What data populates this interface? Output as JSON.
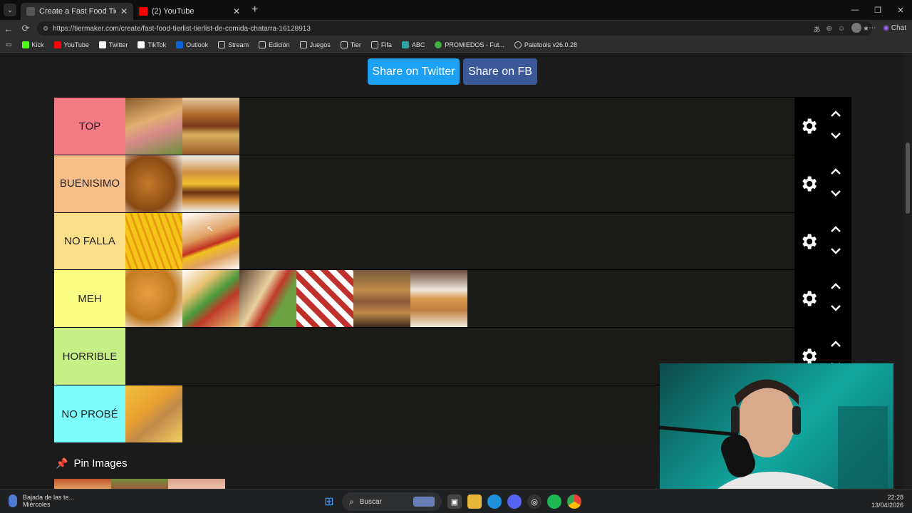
{
  "browser": {
    "tabs": [
      {
        "title": "Create a Fast Food Tierlist/Tierlist",
        "active": true
      },
      {
        "title": "(2) YouTube",
        "active": false
      }
    ],
    "url": "https://tiermaker.com/create/fast-food-tierlist-tierlist-de-comida-chatarra-16128913",
    "chat_label": "Chat",
    "bookmarks": [
      {
        "label": "Kick",
        "icon": "kick-icon",
        "color": "#53fc18"
      },
      {
        "label": "YouTube",
        "icon": "youtube-icon",
        "color": "#ff0000"
      },
      {
        "label": "Twitter",
        "icon": "x-icon",
        "color": "#ffffff"
      },
      {
        "label": "TikTok",
        "icon": "tiktok-icon",
        "color": "#ffffff"
      },
      {
        "label": "Outlook",
        "icon": "outlook-icon",
        "color": "#0a64d6"
      },
      {
        "label": "Stream",
        "icon": "folder-icon",
        "color": "#cccccc"
      },
      {
        "label": "Edición",
        "icon": "folder-icon",
        "color": "#cccccc"
      },
      {
        "label": "Juegos",
        "icon": "folder-icon",
        "color": "#cccccc"
      },
      {
        "label": "Tier",
        "icon": "folder-icon",
        "color": "#cccccc"
      },
      {
        "label": "Fifa",
        "icon": "folder-icon",
        "color": "#cccccc"
      },
      {
        "label": "ABC",
        "icon": "abc-icon",
        "color": "#2ea3a3"
      },
      {
        "label": "PROMIEDOS - Fut...",
        "icon": "promiedos-icon",
        "color": "#3cb043"
      },
      {
        "label": "Paletools v26.0.28",
        "icon": "globe-icon",
        "color": "#cccccc"
      }
    ]
  },
  "page": {
    "share_twitter": "Share on Twitter",
    "share_fb": "Share on FB",
    "pin_images": "Pin Images",
    "tiers": [
      {
        "label": "TOP",
        "color": "#f47a86",
        "items": [
          "sandwich",
          "burger"
        ]
      },
      {
        "label": "BUENISIMO",
        "color": "#f8be88",
        "items": [
          "fried-chicken",
          "cheeseburger"
        ]
      },
      {
        "label": "NO FALLA",
        "color": "#fbde8a",
        "items": [
          "fries",
          "hot-dog"
        ]
      },
      {
        "label": "MEH",
        "color": "#fcfd83",
        "items": [
          "chicken-nuggets",
          "tacos",
          "burrito",
          "kebab",
          "pulled-pork-sandwich",
          "pancakes"
        ]
      },
      {
        "label": "HORRIBLE",
        "color": "#c6f086",
        "items": []
      },
      {
        "label": "NO PROBÉ",
        "color": "#7efdfe",
        "items": [
          "club-sandwich-fries"
        ]
      }
    ]
  },
  "taskbar": {
    "weather_title": "Bajada de las te...",
    "weather_sub": "Miércoles",
    "search": "Buscar",
    "time": "22:28",
    "date": "13/04/2026"
  }
}
